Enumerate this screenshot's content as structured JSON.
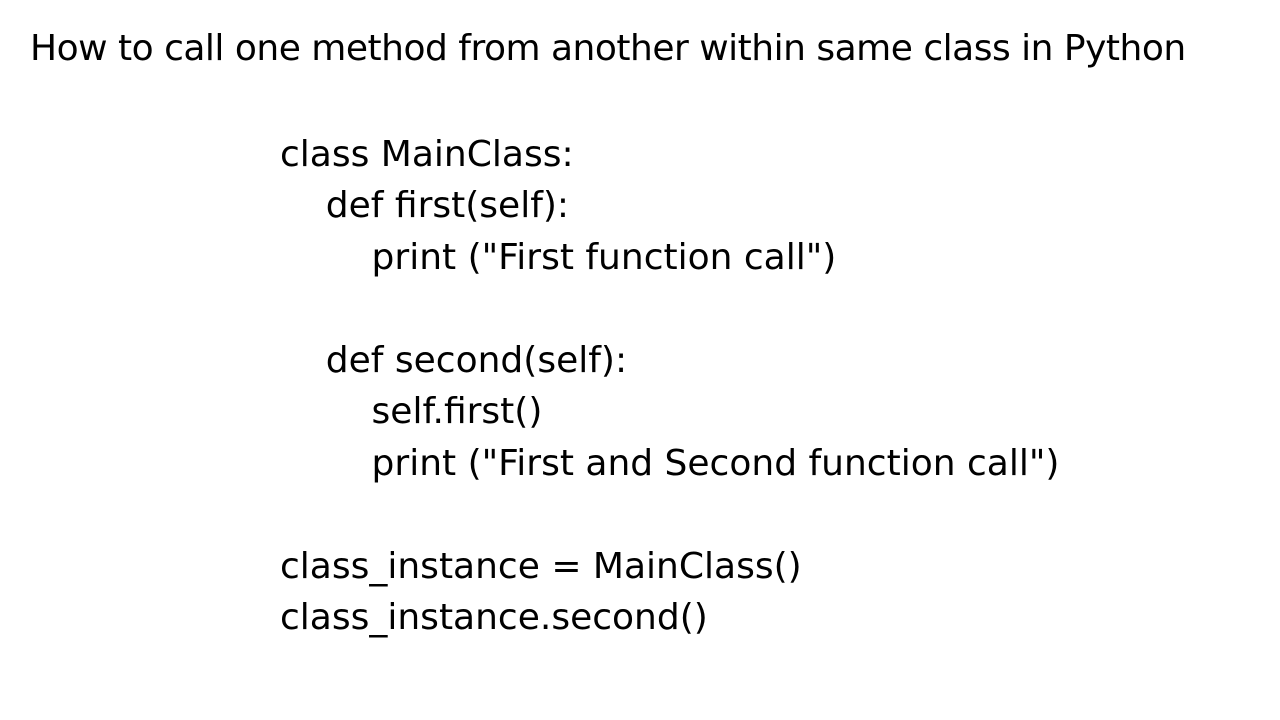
{
  "title": "How to call one method from another within same class in Python",
  "code": {
    "line1": "class MainClass:",
    "line2": "    def first(self):",
    "line3": "        print (\"First function call\")",
    "line4": "",
    "line5": "    def second(self):",
    "line6": "        self.first()",
    "line7": "        print (\"First and Second function call\")",
    "line8": "",
    "line9": "class_instance = MainClass()",
    "line10": "class_instance.second()"
  }
}
